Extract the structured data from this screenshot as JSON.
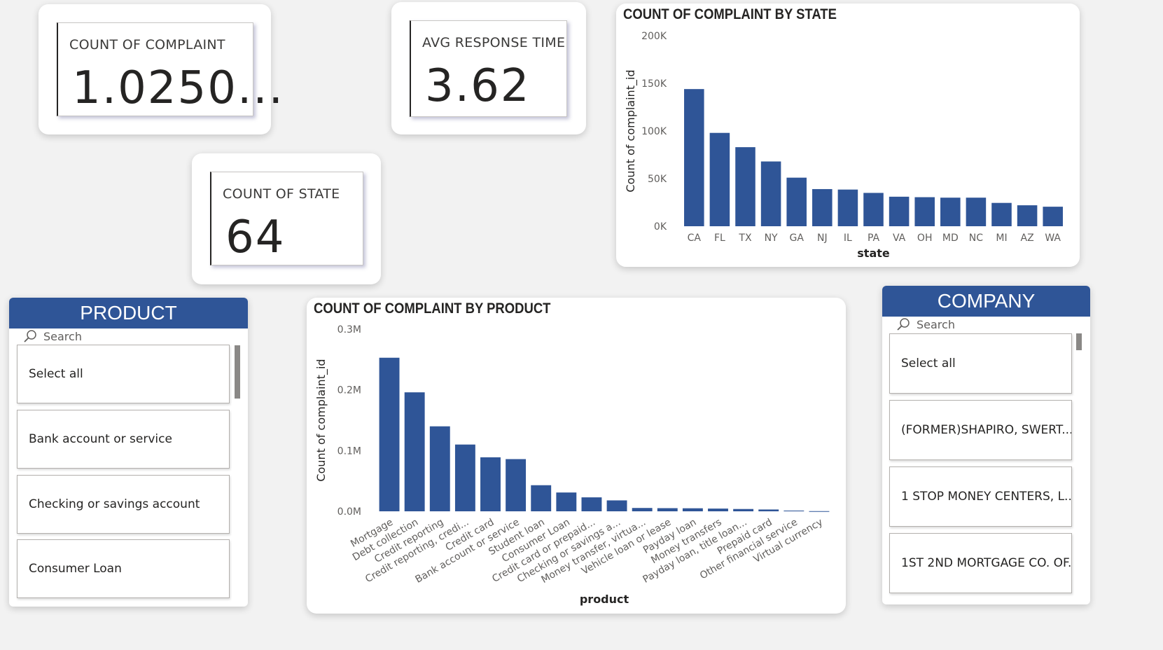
{
  "kpis": {
    "complaints": {
      "label": "COUNT OF COMPLAINT",
      "value": "1.0250..."
    },
    "response": {
      "label": "AVG RESPONSE TIME",
      "value": "3.62"
    },
    "states": {
      "label": "COUNT OF STATE",
      "value": "64"
    }
  },
  "colors": {
    "bar": "#2f5597",
    "header": "#2f5597"
  },
  "state_chart": {
    "title": "COUNT OF COMPLAINT BY STATE",
    "xlabel": "state",
    "ylabel": "Count of complaint_id",
    "yticks": [
      "0K",
      "50K",
      "100K",
      "150K",
      "200K"
    ]
  },
  "product_chart": {
    "title": "COUNT OF COMPLAINT BY PRODUCT",
    "xlabel": "product",
    "ylabel": "Count of complaint_id",
    "yticks": [
      "0.0M",
      "0.1M",
      "0.2M",
      "0.3M"
    ]
  },
  "product_slicer": {
    "header": "PRODUCT",
    "search_placeholder": "Search",
    "search_icon": "search-icon",
    "items": [
      "Select all",
      "Bank account or service",
      "Checking or savings account",
      "Consumer Loan"
    ]
  },
  "company_slicer": {
    "header": "COMPANY",
    "search_placeholder": "Search",
    "search_icon": "search-icon",
    "items": [
      "Select all",
      "(FORMER)SHAPIRO, SWERT...",
      "1 STOP MONEY CENTERS, L...",
      "1ST 2ND MORTGAGE CO. OF..."
    ]
  },
  "chart_data": [
    {
      "type": "bar",
      "title": "COUNT OF COMPLAINT BY STATE",
      "xlabel": "state",
      "ylabel": "Count of complaint_id",
      "ylim": [
        0,
        200000
      ],
      "categories": [
        "CA",
        "FL",
        "TX",
        "NY",
        "GA",
        "NJ",
        "IL",
        "PA",
        "VA",
        "OH",
        "MD",
        "NC",
        "MI",
        "AZ",
        "WA"
      ],
      "values": [
        144000,
        98000,
        83000,
        68000,
        51000,
        39000,
        38500,
        35000,
        31000,
        30500,
        30000,
        30000,
        24500,
        22000,
        20500
      ]
    },
    {
      "type": "bar",
      "title": "COUNT OF COMPLAINT BY PRODUCT",
      "xlabel": "product",
      "ylabel": "Count of complaint_id",
      "ylim": [
        0,
        300000
      ],
      "categories": [
        "Mortgage",
        "Debt collection",
        "Credit reporting",
        "Credit reporting, credi...",
        "Credit card",
        "Bank account or service",
        "Student loan",
        "Consumer Loan",
        "Credit card or prepaid...",
        "Checking or savings a...",
        "Money transfer, virtua...",
        "Vehicle loan or lease",
        "Payday loan",
        "Money transfers",
        "Payday loan, title loan...",
        "Prepaid card",
        "Other financial service",
        "Virtual currency"
      ],
      "values": [
        253000,
        196000,
        140000,
        110000,
        89000,
        86000,
        43000,
        31000,
        23000,
        18000,
        5500,
        5200,
        5000,
        4500,
        3800,
        3000,
        1200,
        300
      ]
    }
  ]
}
